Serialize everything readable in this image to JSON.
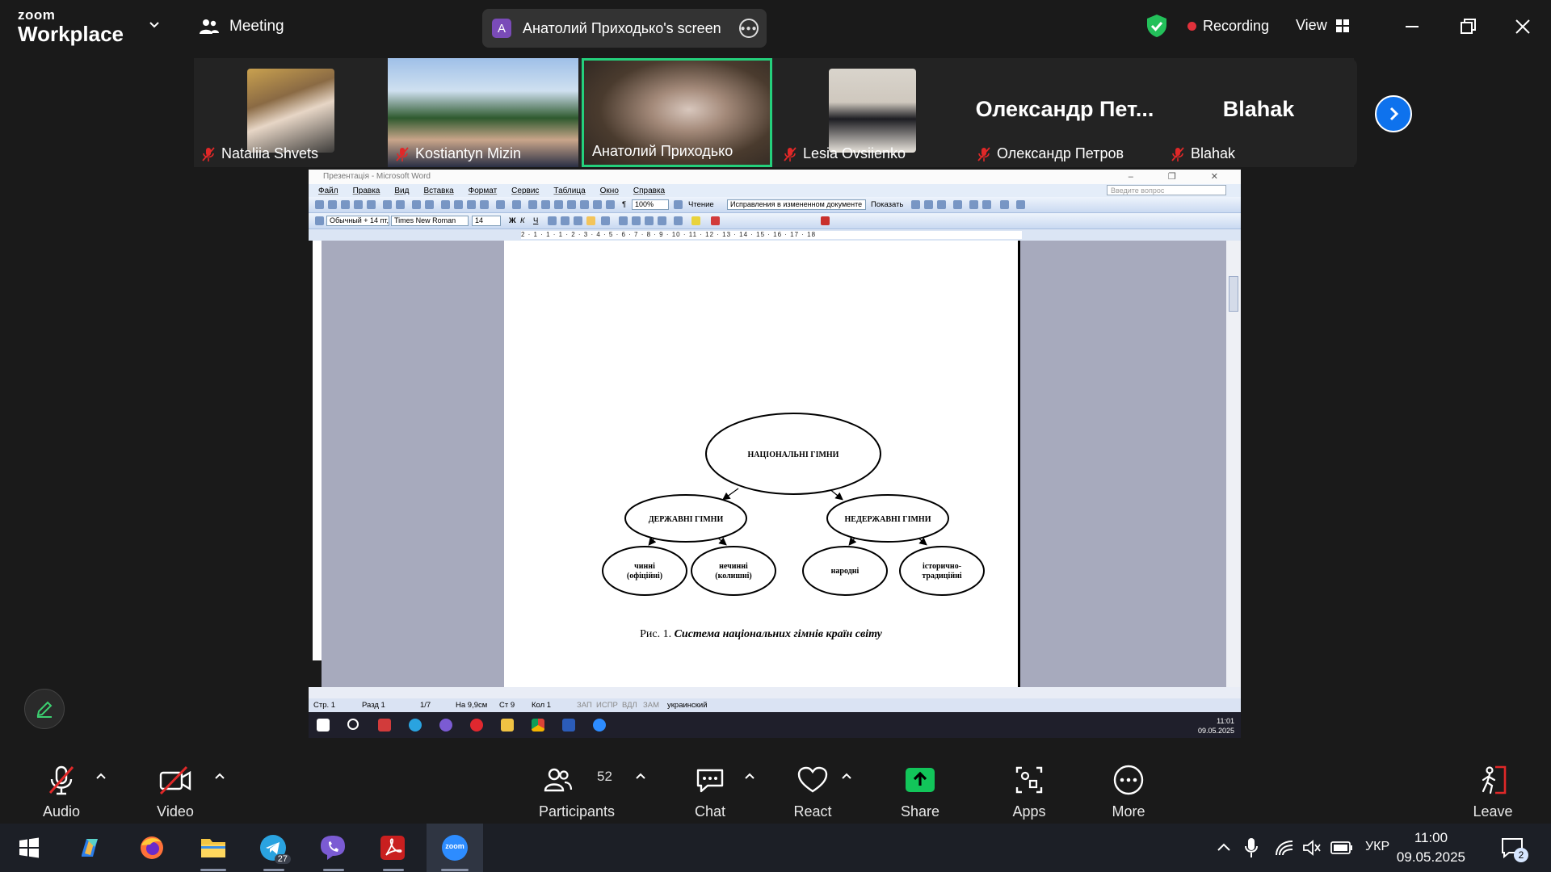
{
  "zoom": {
    "brand_small": "zoom",
    "brand_large": "Workplace",
    "meeting_label": "Meeting",
    "share_avatar_letter": "A",
    "share_title": "Анатолий Приходько's screen",
    "recording_label": "Recording",
    "view_label": "View",
    "accent_blue": "#0e72ed",
    "active_speaker_color": "#24d07c"
  },
  "participants": [
    {
      "name": "Nataliia Shvets",
      "muted": true
    },
    {
      "name": "Kostiantyn Mizin",
      "muted": true
    },
    {
      "name": "Анатолий Приходько",
      "muted": false,
      "active": true
    },
    {
      "name": "Lesia Ovsiienko",
      "muted": true
    },
    {
      "name": "Олександр Петров",
      "display": "Олександр  Пет...",
      "muted": true
    },
    {
      "name": "Blahak",
      "display": "Blahak",
      "muted": true
    }
  ],
  "word": {
    "window_title": "Презентація - Microsoft Word",
    "menu": [
      "Файл",
      "Правка",
      "Вид",
      "Вставка",
      "Формат",
      "Сервис",
      "Таблица",
      "Окно",
      "Справка"
    ],
    "ask_placeholder": "Введите вопрос",
    "zoom_value": "100%",
    "reading_label": "Чтение",
    "track_changes": "Исправления в измененном документе",
    "show_label": "Показать",
    "style_value": "Обычный + 14 пт,",
    "font_value": "Times New Roman",
    "size_value": "14",
    "bold": "Ж",
    "italic": "К",
    "underline": "Ч",
    "ruler_text": "2 · 1 · 1 · 1 · 2 · 3 · 4 · 5 · 6 · 7 · 8 · 9 · 10 · 11 · 12 · 13 · 14 · 15 · 16 · 17 · 18",
    "status": {
      "page": "Стр. 1",
      "section": "Разд 1",
      "pages": "1/7",
      "at": "На 9,9см",
      "line": "Ст 9",
      "col": "Кол 1",
      "rec": "ЗАП",
      "trk": "ИСПР",
      "ext": "ВДЛ",
      "ovr": "ЗАМ",
      "lang": "украинский"
    },
    "taskbar_time": "11:01",
    "taskbar_date": "09.05.2025"
  },
  "diagram": {
    "root": "НАЦІОНАЛЬНІ ГІМНИ",
    "left": "ДЕРЖАВНІ ГІМНИ",
    "right": "НЕДЕРЖАВНІ ГІМНИ",
    "ll_1": "чинні",
    "ll_2": "(офіційні)",
    "lr_1": "нечинні",
    "lr_2": "(колишні)",
    "rl": "народні",
    "rr_1": "історично-",
    "rr_2": "традиційні",
    "caption_prefix": "Рис. 1.",
    "caption_title": "Система національних гімнів країн світу"
  },
  "controls": {
    "audio": "Audio",
    "video": "Video",
    "participants": "Participants",
    "participants_count": "52",
    "chat": "Chat",
    "react": "React",
    "share": "Share",
    "apps": "Apps",
    "more": "More",
    "leave": "Leave",
    "share_color": "#12c55a",
    "leave_color": "#e02828"
  },
  "taskbar": {
    "zoom_label": "zoom",
    "telegram_badge": "27",
    "lang": "УКР",
    "time": "11:00",
    "date": "09.05.2025",
    "notif_count": "2"
  }
}
